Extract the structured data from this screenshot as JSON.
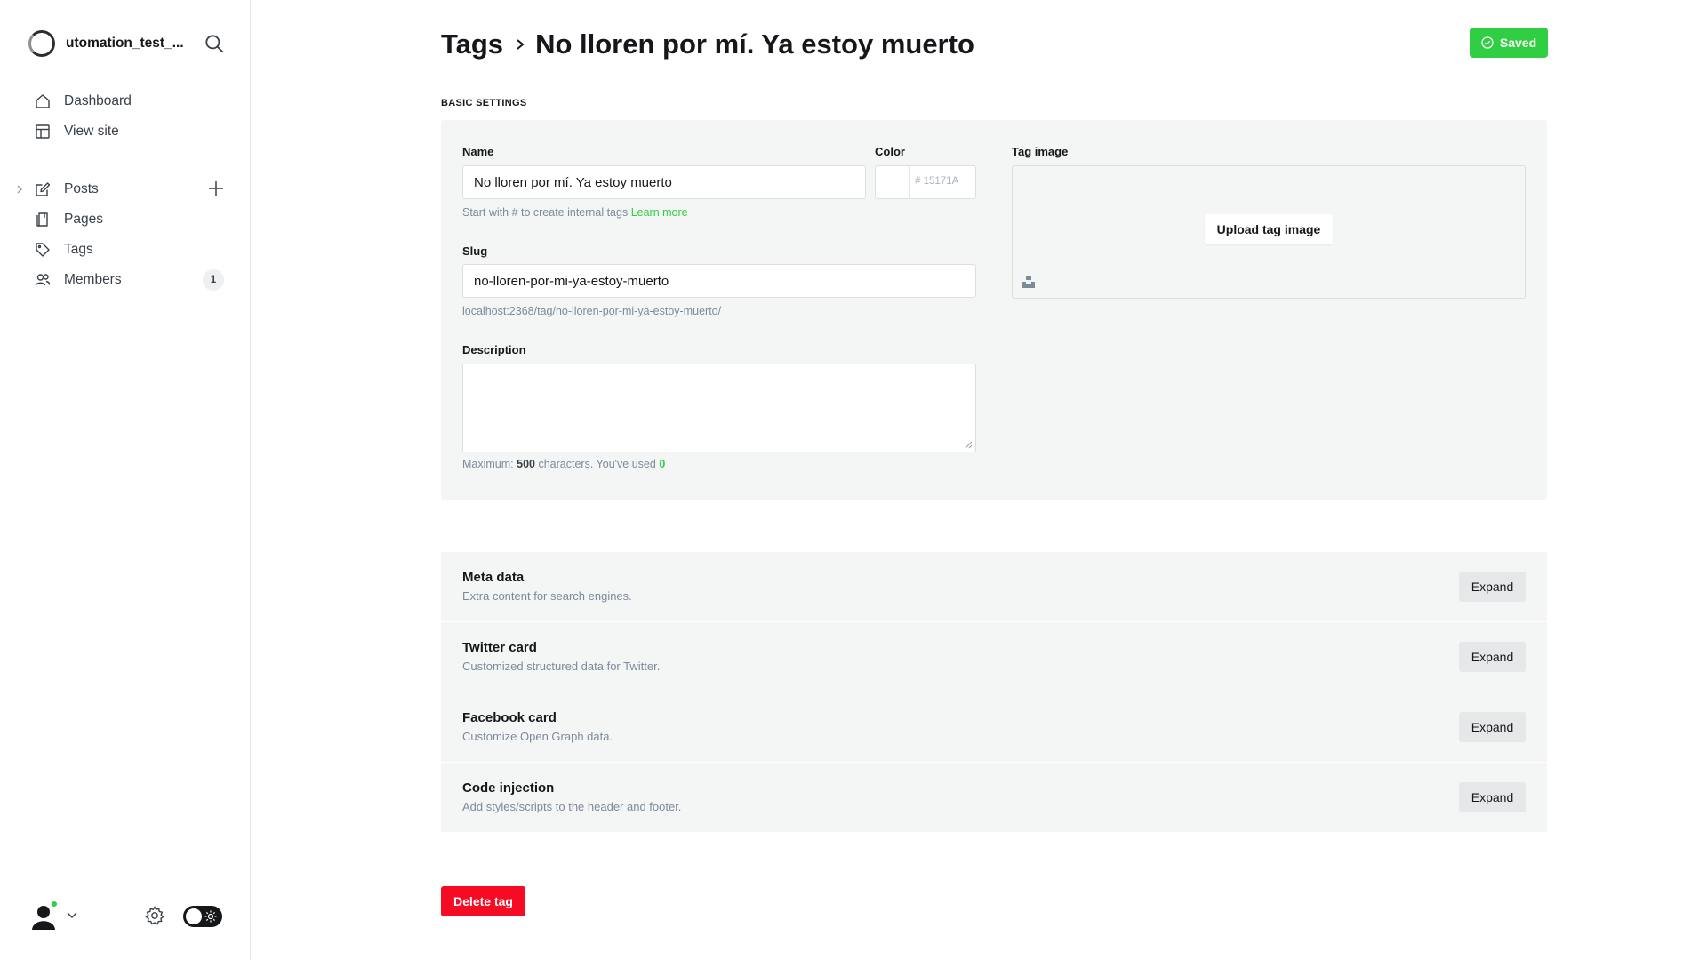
{
  "sidebar": {
    "site_name": "utomation_test_...",
    "nav": [
      {
        "label": "Dashboard",
        "icon": "home-icon"
      },
      {
        "label": "View site",
        "icon": "layout-icon"
      },
      {
        "label": "Posts",
        "icon": "pencil-icon"
      },
      {
        "label": "Pages",
        "icon": "page-icon"
      },
      {
        "label": "Tags",
        "icon": "tag-icon"
      },
      {
        "label": "Members",
        "icon": "members-icon",
        "count": "1"
      }
    ]
  },
  "header": {
    "breadcrumb_parent": "Tags",
    "breadcrumb_current": "No lloren por mí. Ya estoy muerto",
    "saved_label": "Saved"
  },
  "basic_settings": {
    "section_title": "BASIC SETTINGS",
    "name_label": "Name",
    "name_value": "No lloren por mí. Ya estoy muerto",
    "name_hint": "Start with # to create internal tags",
    "name_hint_link": "Learn more",
    "color_label": "Color",
    "color_placeholder": "# 15171A",
    "slug_label": "Slug",
    "slug_value": "no-lloren-por-mi-ya-estoy-muerto",
    "slug_url": "localhost:2368/tag/no-lloren-por-mi-ya-estoy-muerto/",
    "description_label": "Description",
    "description_value": "",
    "description_hint_prefix": "Maximum:",
    "description_max": "500",
    "description_hint_mid": "characters. You've used",
    "description_used": "0",
    "tag_image_label": "Tag image",
    "upload_label": "Upload tag image"
  },
  "accordion": [
    {
      "title": "Meta data",
      "desc": "Extra content for search engines.",
      "button": "Expand"
    },
    {
      "title": "Twitter card",
      "desc": "Customized structured data for Twitter.",
      "button": "Expand"
    },
    {
      "title": "Facebook card",
      "desc": "Customize Open Graph data.",
      "button": "Expand"
    },
    {
      "title": "Code injection",
      "desc": "Add styles/scripts to the header and footer.",
      "button": "Expand"
    }
  ],
  "delete_label": "Delete tag",
  "colors": {
    "accent_green": "#30cf43",
    "danger_red": "#f50b23",
    "panel_bg": "#f4f5f5",
    "text_dark": "#15171a"
  }
}
